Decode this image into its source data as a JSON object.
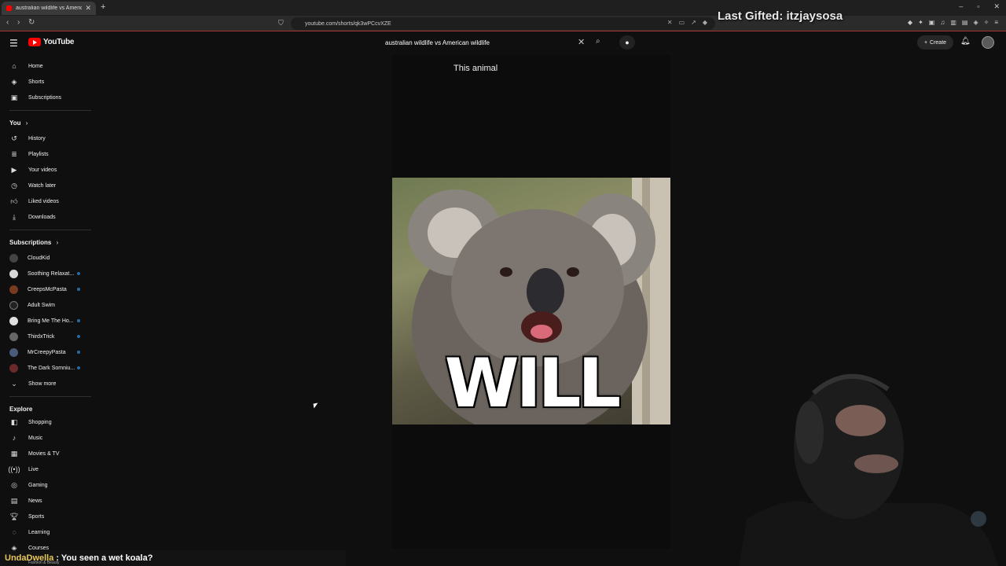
{
  "browser": {
    "tab_title": "australian wildlife vs America",
    "url": "youtube.com/shorts/qk3wPCcvXZE"
  },
  "stream_overlay": {
    "last_gifted": "Last Gifted: itzjaysosa",
    "chat_user": "UndaDwella",
    "chat_message": ": You seen a wet koala?"
  },
  "header": {
    "logo_text": "YouTube",
    "search_value": "australian wildlife vs American wildlife",
    "create_label": "Create"
  },
  "sidebar": {
    "main": [
      {
        "label": "Home",
        "icon": "home-icon"
      },
      {
        "label": "Shorts",
        "icon": "shorts-icon"
      },
      {
        "label": "Subscriptions",
        "icon": "subscriptions-icon"
      }
    ],
    "you_heading": "You",
    "you": [
      {
        "label": "History",
        "icon": "history-icon"
      },
      {
        "label": "Playlists",
        "icon": "playlists-icon"
      },
      {
        "label": "Your videos",
        "icon": "your-videos-icon"
      },
      {
        "label": "Watch later",
        "icon": "watch-later-icon"
      },
      {
        "label": "Liked videos",
        "icon": "liked-videos-icon"
      },
      {
        "label": "Downloads",
        "icon": "downloads-icon"
      }
    ],
    "subs_heading": "Subscriptions",
    "subs": [
      {
        "label": "CloudKid",
        "color": "#444444"
      },
      {
        "label": "Soothing Relaxat...",
        "color": "#d8d8d8"
      },
      {
        "label": "CreepsMcPasta",
        "color": "#7a3a20"
      },
      {
        "label": "Adult Swim",
        "color": "#222222"
      },
      {
        "label": "Bring Me The Ho...",
        "color": "#e0e0e0"
      },
      {
        "label": "ThirdxTrick",
        "color": "#666666"
      },
      {
        "label": "MrCreepyPasta",
        "color": "#4a5a7a"
      },
      {
        "label": "The Dark Somniu...",
        "color": "#6a2a2a"
      }
    ],
    "show_more": "Show more",
    "explore_heading": "Explore",
    "explore": [
      {
        "label": "Shopping",
        "icon": "shopping-icon"
      },
      {
        "label": "Music",
        "icon": "music-icon"
      },
      {
        "label": "Movies & TV",
        "icon": "movies-icon"
      },
      {
        "label": "Live",
        "icon": "live-icon"
      },
      {
        "label": "Gaming",
        "icon": "gaming-icon"
      },
      {
        "label": "News",
        "icon": "news-icon"
      },
      {
        "label": "Sports",
        "icon": "sports-icon"
      },
      {
        "label": "Learning",
        "icon": "learning-icon"
      },
      {
        "label": "Courses",
        "icon": "courses-icon"
      }
    ],
    "fashion_label": "Fashion & Beauty"
  },
  "short": {
    "caption": "This animal",
    "overlay_text": "WILL"
  }
}
